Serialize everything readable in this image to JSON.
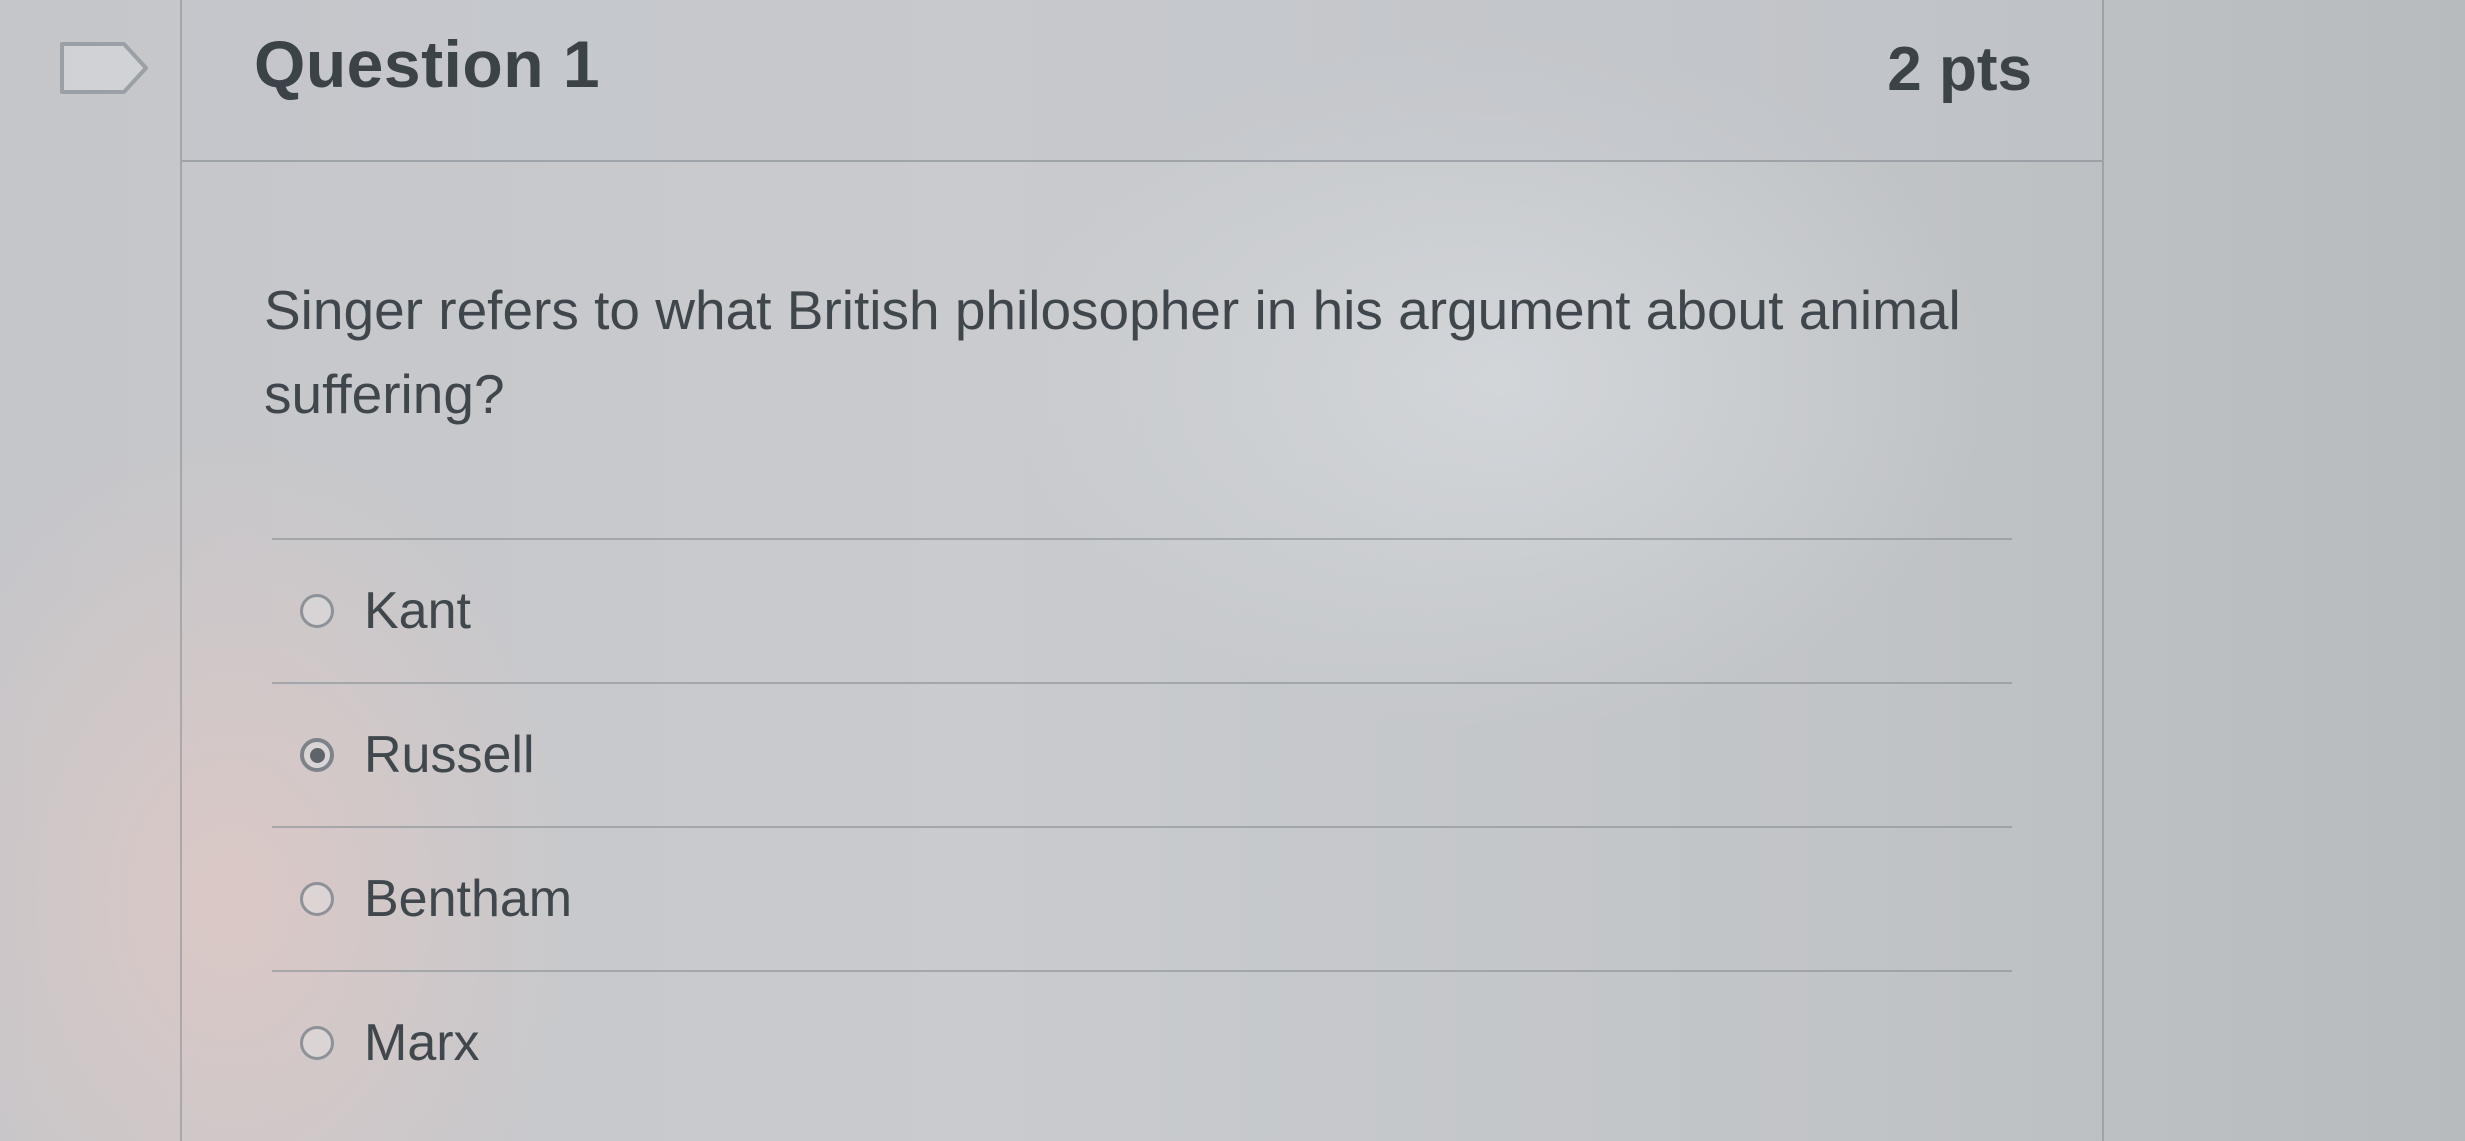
{
  "question": {
    "title": "Question 1",
    "points": "2 pts",
    "text": "Singer refers to what British philosopher in his argument about animal suffering?"
  },
  "answers": [
    {
      "label": "Kant",
      "selected": false
    },
    {
      "label": "Russell",
      "selected": true
    },
    {
      "label": "Bentham",
      "selected": false
    },
    {
      "label": "Marx",
      "selected": false
    }
  ],
  "icons": {
    "flag": "flag-question-icon"
  }
}
